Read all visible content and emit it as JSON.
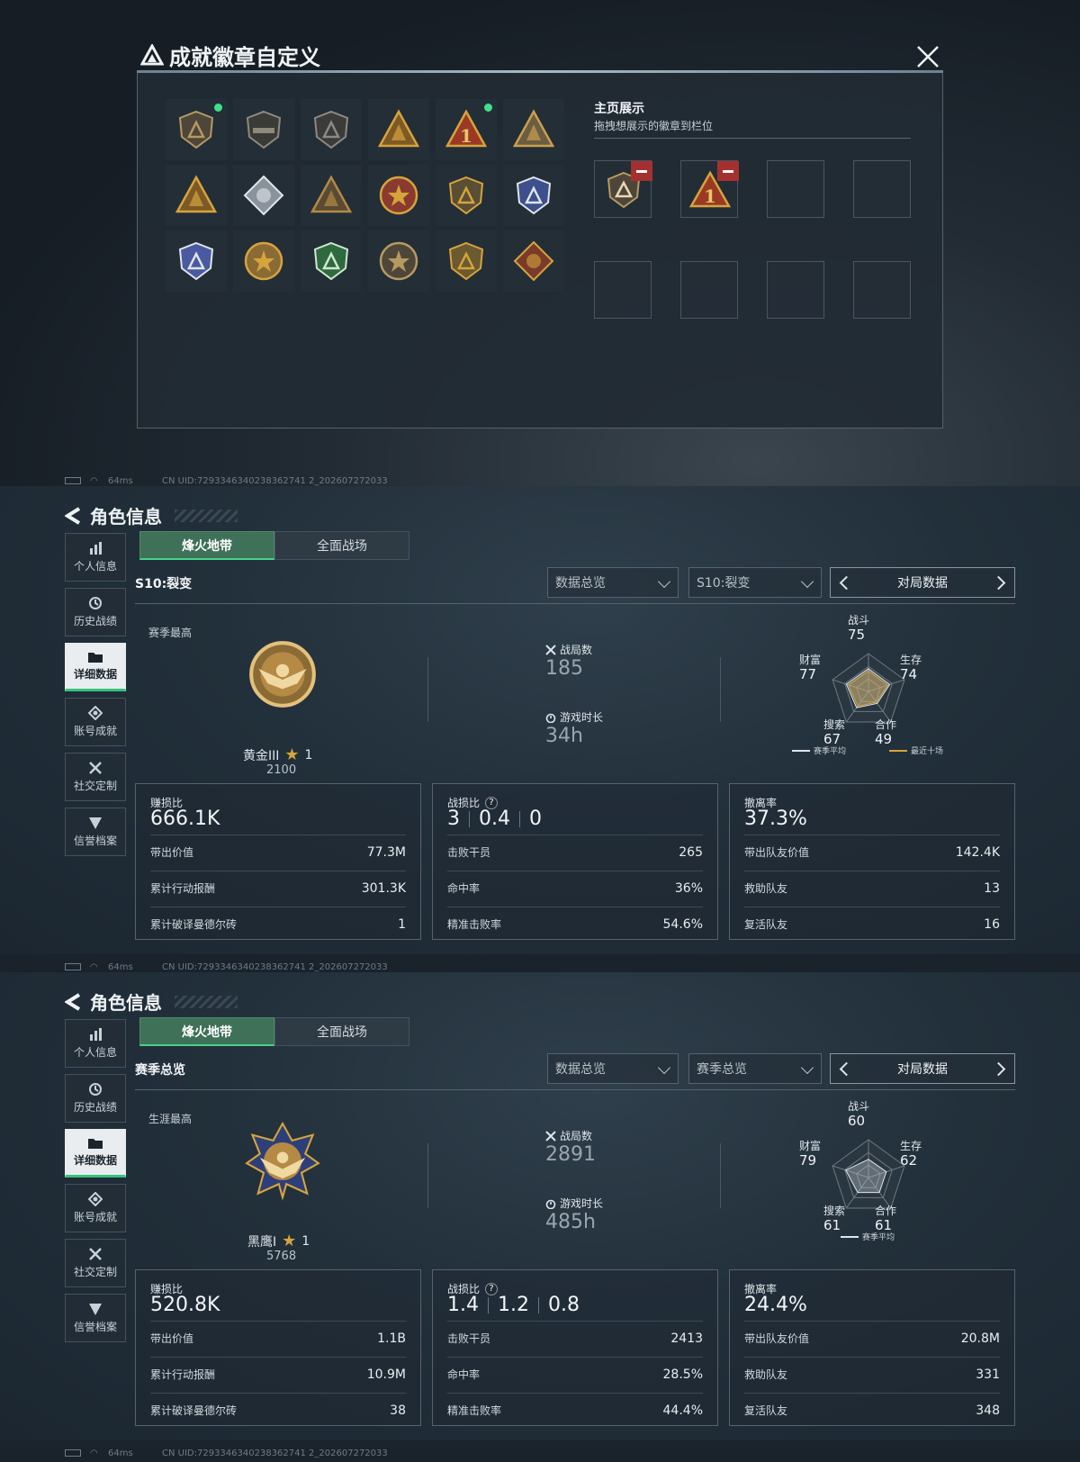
{
  "modal": {
    "title": "成就徽章自定义",
    "showcase_title": "主页展示",
    "showcase_subtitle": "拖拽想展示的徽章到栏位"
  },
  "status": {
    "ping": "64ms",
    "uid": "CN UID:7293346340238362741 2_202607272033"
  },
  "panels": [
    {
      "page_title": "角色信息",
      "sidebar": [
        "个人信息",
        "历史战绩",
        "详细数据",
        "账号成就",
        "社交定制",
        "信誉档案"
      ],
      "tabs": [
        "烽火地带",
        "全面战场"
      ],
      "section_title": "S10:裂变",
      "dropdown1": "数据总览",
      "dropdown2": "S10:裂变",
      "pager": "对局数据",
      "best_label": "赛季最高",
      "rank_name": "黄金III",
      "rank_stars": "1",
      "rank_score": "2100",
      "matches_label": "战局数",
      "matches": "185",
      "time_label": "游戏时长",
      "time": "34h",
      "radar": {
        "combat": "75",
        "survive": "74",
        "coop": "49",
        "search": "67",
        "wealth": "77",
        "labels": {
          "combat": "战斗",
          "survive": "生存",
          "coop": "合作",
          "search": "搜索",
          "wealth": "财富"
        },
        "legend": [
          "赛季平均",
          "最近十场"
        ]
      },
      "box1": {
        "title": "赚损比",
        "value": "666.1K",
        "rows": [
          [
            "带出价值",
            "77.3M"
          ],
          [
            "累计行动报酬",
            "301.3K"
          ],
          [
            "累计破译曼德尔砖",
            "1"
          ]
        ]
      },
      "box2": {
        "title": "战损比",
        "vals": [
          "3",
          "0.4",
          "0"
        ],
        "rows": [
          [
            "击败干员",
            "265"
          ],
          [
            "命中率",
            "36%"
          ],
          [
            "精准击败率",
            "54.6%"
          ]
        ]
      },
      "box3": {
        "title": "撤离率",
        "value": "37.3%",
        "rows": [
          [
            "带出队友价值",
            "142.4K"
          ],
          [
            "救助队友",
            "13"
          ],
          [
            "复活队友",
            "16"
          ]
        ]
      }
    },
    {
      "page_title": "角色信息",
      "sidebar": [
        "个人信息",
        "历史战绩",
        "详细数据",
        "账号成就",
        "社交定制",
        "信誉档案"
      ],
      "tabs": [
        "烽火地带",
        "全面战场"
      ],
      "section_title": "赛季总览",
      "dropdown1": "数据总览",
      "dropdown2": "赛季总览",
      "pager": "对局数据",
      "best_label": "生涯最高",
      "rank_name": "黑鹰I",
      "rank_stars": "1",
      "rank_score": "5768",
      "matches_label": "战局数",
      "matches": "2891",
      "time_label": "游戏时长",
      "time": "485h",
      "radar": {
        "combat": "60",
        "survive": "62",
        "coop": "61",
        "search": "61",
        "wealth": "79",
        "labels": {
          "combat": "战斗",
          "survive": "生存",
          "coop": "合作",
          "search": "搜索",
          "wealth": "财富"
        },
        "legend": [
          "赛季平均"
        ]
      },
      "box1": {
        "title": "赚损比",
        "value": "520.8K",
        "rows": [
          [
            "带出价值",
            "1.1B"
          ],
          [
            "累计行动报酬",
            "10.9M"
          ],
          [
            "累计破译曼德尔砖",
            "38"
          ]
        ]
      },
      "box2": {
        "title": "战损比",
        "vals": [
          "1.4",
          "1.2",
          "0.8"
        ],
        "rows": [
          [
            "击败干员",
            "2413"
          ],
          [
            "命中率",
            "28.5%"
          ],
          [
            "精准击败率",
            "44.4%"
          ]
        ]
      },
      "box3": {
        "title": "撤离率",
        "value": "24.4%",
        "rows": [
          [
            "带出队友价值",
            "20.8M"
          ],
          [
            "救助队友",
            "331"
          ],
          [
            "复活队友",
            "348"
          ]
        ]
      }
    }
  ],
  "colors": {
    "accent": "#46d38b",
    "gold": "#d6a43c",
    "danger": "#a4312f"
  }
}
